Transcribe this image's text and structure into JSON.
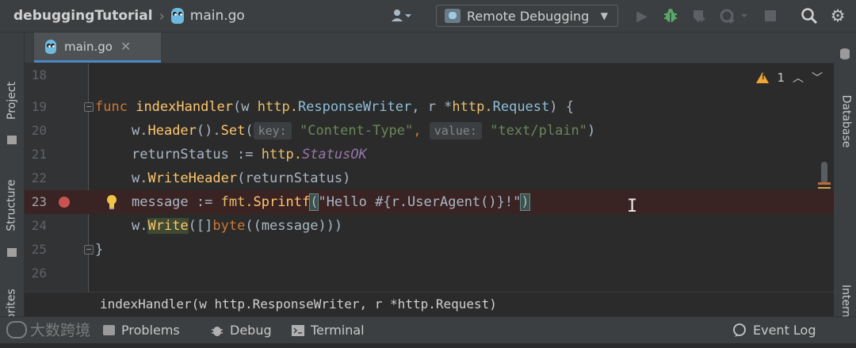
{
  "toolbar": {
    "project_name": "debuggingTutorial",
    "current_file": "main.go",
    "run_config": "Remote Debugging",
    "icons": [
      "user-icon",
      "run-icon",
      "debug-icon",
      "coverage-icon",
      "profile-icon",
      "stop-icon",
      "search-icon",
      "settings-icon"
    ]
  },
  "left_strip": {
    "project_label": "Project",
    "structure_label": "Structure",
    "favorites_label": "Favorites"
  },
  "right_strip": {
    "database_label": "Database",
    "internal_label": "Internal"
  },
  "tabs": [
    {
      "label": "main.go",
      "active": true
    }
  ],
  "editor": {
    "warnings_count": "1",
    "lines": [
      {
        "num": "18"
      },
      {
        "num": "19",
        "text": "func indexHandler(w http.ResponseWriter, r *http.Request) {"
      },
      {
        "num": "20",
        "text": "w.Header().Set(key: \"Content-Type\", value: \"text/plain\")"
      },
      {
        "num": "21",
        "text": "returnStatus := http.StatusOK"
      },
      {
        "num": "22",
        "text": "w.WriteHeader(returnStatus)"
      },
      {
        "num": "23",
        "text": "message := fmt.Sprintf(\"Hello #{r.UserAgent()}!\")",
        "breakpoint": true
      },
      {
        "num": "24",
        "text": "w.Write([]byte((message)))"
      },
      {
        "num": "25",
        "text": "}"
      },
      {
        "num": "26"
      }
    ],
    "tokens": {
      "l19": [
        "func",
        "indexHandler",
        "(w ",
        "http.",
        "ResponseWriter",
        ", r *",
        "http.",
        "Request",
        ") {"
      ],
      "l20": [
        "w.",
        "Header",
        "().",
        "Set",
        "(",
        "key:",
        "\"Content-Type\"",
        ", ",
        "value:",
        "\"text/plain\"",
        ")"
      ],
      "l21": [
        "returnStatus := ",
        "http.",
        "StatusOK"
      ],
      "l22": [
        "w.",
        "WriteHeader",
        "(returnStatus)"
      ],
      "l23": [
        "message := ",
        "fmt.",
        "Sprintf",
        "(",
        "\"Hello #{",
        "r.UserAgent()",
        "}!\"",
        ")"
      ],
      "l24": [
        "w.",
        "Write",
        "([]",
        "byte",
        "((message)))"
      ],
      "l25": [
        "}"
      ]
    }
  },
  "breadcrumb": "indexHandler(w http.ResponseWriter, r *http.Request)",
  "toolwindows": {
    "problems": "Problems",
    "debug": "Debug",
    "terminal": "Terminal",
    "event_log": "Event Log"
  },
  "watermark": "大数跨境",
  "colors": {
    "background": "#2b2b2b",
    "toolbar": "#3c3f41",
    "keyword": "#cc7832",
    "function": "#ffc66d",
    "type": "#6897bb",
    "string": "#6a8759",
    "breakpoint": "#c75450",
    "accent": "#4a88c7"
  }
}
